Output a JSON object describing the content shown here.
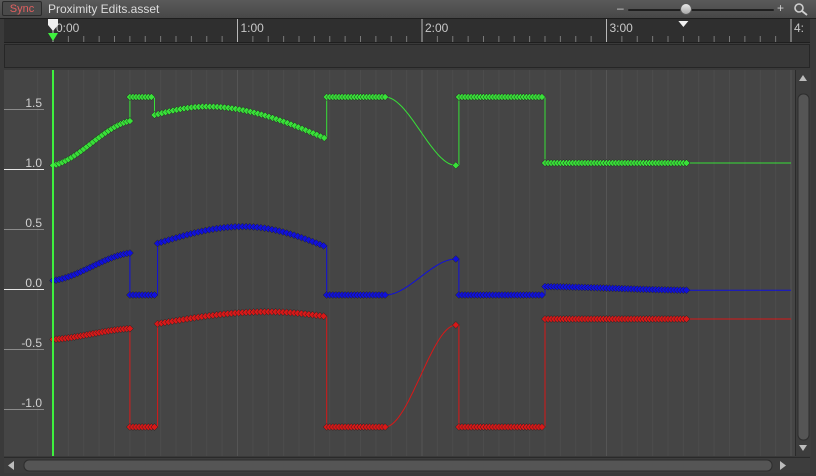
{
  "toolbar": {
    "sync_label": "Sync",
    "asset_title": "Proximity Edits.asset",
    "zoom_minus": "–",
    "zoom_plus": "+",
    "zoom_value": 0.4,
    "search_icon": "search-icon"
  },
  "colors": {
    "accent_green": "#3ef03e",
    "curve_green": "#38e038",
    "curve_blue": "#1010dc",
    "curve_red": "#d81818"
  },
  "chart_data": {
    "type": "line",
    "x_ticks": [
      {
        "t": 0,
        "label": "0:00"
      },
      {
        "t": 60,
        "label": "1:00"
      },
      {
        "t": 120,
        "label": "2:00"
      },
      {
        "t": 180,
        "label": "3:00"
      },
      {
        "t": 240,
        "label": "4:"
      }
    ],
    "y_ticks": [
      {
        "v": 1.5,
        "label": "1.5"
      },
      {
        "v": 1.0,
        "label": "1.0"
      },
      {
        "v": 0.5,
        "label": "0.5"
      },
      {
        "v": 0.0,
        "label": "0.0"
      },
      {
        "v": -0.5,
        "label": "-0.5"
      },
      {
        "v": -1.0,
        "label": "-1.0"
      }
    ],
    "xlim": [
      0,
      240
    ],
    "ylim": [
      -1.2,
      1.7
    ],
    "playhead_t": 0,
    "end_marker_t": 205,
    "series": [
      {
        "color": "#38e038",
        "segments": [
          {
            "kind": "keys",
            "t0": 0,
            "t1": 25,
            "step": 1,
            "shape": "rise",
            "v0": 1.03,
            "v1": 1.4
          },
          {
            "kind": "keys",
            "t0": 25,
            "t1": 32,
            "step": 1,
            "shape": "flat",
            "v0": 1.6,
            "v1": 1.6
          },
          {
            "kind": "keys",
            "t0": 33,
            "t1": 89,
            "step": 1.2,
            "shape": "arch",
            "v0": 1.45,
            "v1": 1.25,
            "peak": 1.52,
            "peak_t": 50
          },
          {
            "kind": "keys",
            "t0": 89,
            "t1": 108,
            "step": 1,
            "shape": "flat",
            "v0": 1.6,
            "v1": 1.6
          },
          {
            "kind": "smooth",
            "t0": 108,
            "t1": 131,
            "v0": 1.6,
            "v1": 1.03
          },
          {
            "kind": "keys",
            "t0": 131,
            "t1": 131,
            "step": 1,
            "shape": "flat",
            "v0": 1.03,
            "v1": 1.03
          },
          {
            "kind": "keys",
            "t0": 132,
            "t1": 159,
            "step": 1,
            "shape": "flat",
            "v0": 1.6,
            "v1": 1.6
          },
          {
            "kind": "keys",
            "t0": 160,
            "t1": 206,
            "step": 1,
            "shape": "flat",
            "v0": 1.05,
            "v1": 1.05
          },
          {
            "kind": "tail",
            "t0": 206,
            "t1": 240,
            "v0": 1.05,
            "v1": 1.05
          }
        ]
      },
      {
        "color": "#1010dc",
        "segments": [
          {
            "kind": "keys",
            "t0": 0,
            "t1": 25,
            "step": 1,
            "shape": "rise",
            "v0": 0.07,
            "v1": 0.3
          },
          {
            "kind": "keys",
            "t0": 25,
            "t1": 33,
            "step": 1,
            "shape": "flat",
            "v0": -0.05,
            "v1": -0.05
          },
          {
            "kind": "keys",
            "t0": 34,
            "t1": 89,
            "step": 1.2,
            "shape": "arch",
            "v0": 0.38,
            "v1": 0.35,
            "peak": 0.52,
            "peak_t": 62
          },
          {
            "kind": "keys",
            "t0": 89,
            "t1": 108,
            "step": 1,
            "shape": "flat",
            "v0": -0.05,
            "v1": -0.05
          },
          {
            "kind": "smooth",
            "t0": 108,
            "t1": 131,
            "v0": -0.05,
            "v1": 0.25
          },
          {
            "kind": "keys",
            "t0": 131,
            "t1": 131,
            "step": 1,
            "shape": "flat",
            "v0": 0.25,
            "v1": 0.25
          },
          {
            "kind": "keys",
            "t0": 132,
            "t1": 159,
            "step": 1,
            "shape": "flat",
            "v0": -0.05,
            "v1": -0.05
          },
          {
            "kind": "keys",
            "t0": 160,
            "t1": 206,
            "step": 1,
            "shape": "fall",
            "v0": 0.02,
            "v1": -0.01
          },
          {
            "kind": "tail",
            "t0": 206,
            "t1": 240,
            "v0": -0.01,
            "v1": -0.01
          }
        ]
      },
      {
        "color": "#d81818",
        "segments": [
          {
            "kind": "keys",
            "t0": 0,
            "t1": 25,
            "step": 1,
            "shape": "rise",
            "v0": -0.42,
            "v1": -0.33
          },
          {
            "kind": "keys",
            "t0": 25,
            "t1": 33,
            "step": 1,
            "shape": "flat",
            "v0": -1.15,
            "v1": -1.15
          },
          {
            "kind": "keys",
            "t0": 34,
            "t1": 89,
            "step": 1.2,
            "shape": "arch",
            "v0": -0.29,
            "v1": -0.23,
            "peak": -0.19,
            "peak_t": 70
          },
          {
            "kind": "keys",
            "t0": 89,
            "t1": 108,
            "step": 1,
            "shape": "flat",
            "v0": -1.15,
            "v1": -1.15
          },
          {
            "kind": "smooth",
            "t0": 108,
            "t1": 131,
            "v0": -1.15,
            "v1": -0.3
          },
          {
            "kind": "keys",
            "t0": 131,
            "t1": 131,
            "step": 1,
            "shape": "flat",
            "v0": -0.3,
            "v1": -0.3
          },
          {
            "kind": "keys",
            "t0": 132,
            "t1": 159,
            "step": 1,
            "shape": "flat",
            "v0": -1.15,
            "v1": -1.15
          },
          {
            "kind": "keys",
            "t0": 160,
            "t1": 206,
            "step": 1,
            "shape": "flat",
            "v0": -0.25,
            "v1": -0.25
          },
          {
            "kind": "tail",
            "t0": 206,
            "t1": 240,
            "v0": -0.25,
            "v1": -0.25
          }
        ]
      }
    ]
  }
}
